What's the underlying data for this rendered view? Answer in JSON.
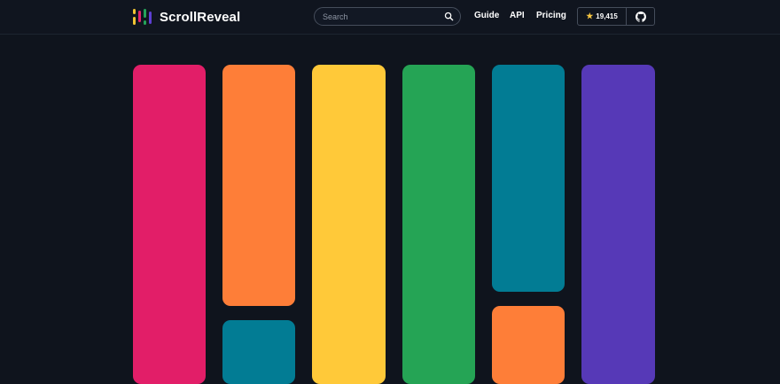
{
  "header": {
    "logo_text": "ScrollReveal",
    "logo_colors": [
      "#f0c433",
      "#e4216c",
      "#25a35a",
      "#5d3fd3"
    ],
    "search": {
      "placeholder": "Search",
      "value": ""
    },
    "nav": [
      {
        "label": "Guide"
      },
      {
        "label": "API"
      },
      {
        "label": "Pricing"
      }
    ],
    "github": {
      "stars": "19,415",
      "star_icon": "star-icon",
      "icon": "github-icon"
    }
  },
  "colors": {
    "background": "#0f141d",
    "tiles": {
      "pink": "#e21e68",
      "orange": "#fe7e38",
      "teal": "#027c94",
      "yellow": "#ffc939",
      "green": "#25a455",
      "purple": "#5639b7"
    }
  }
}
